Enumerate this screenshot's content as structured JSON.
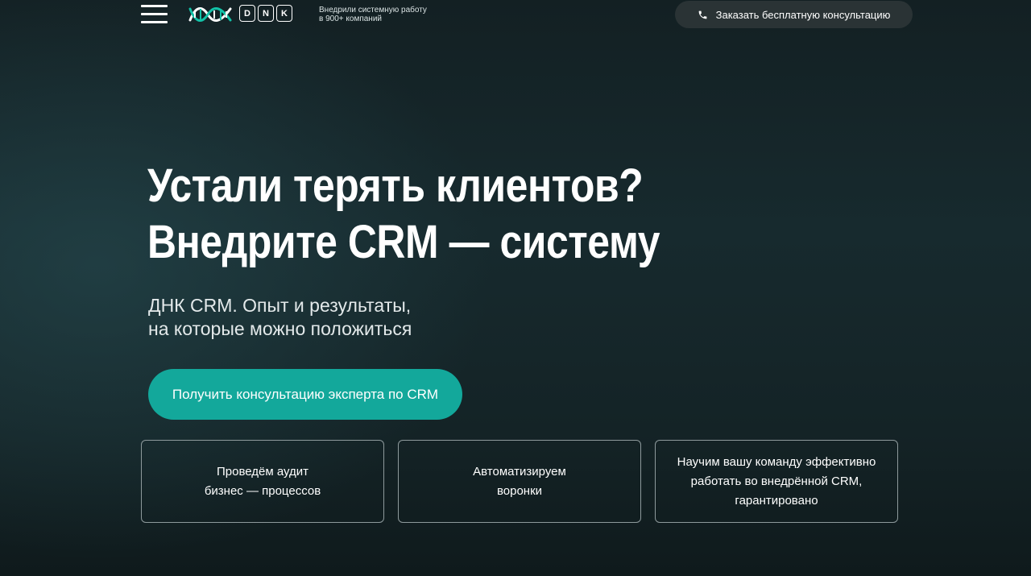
{
  "header": {
    "menu_icon": "hamburger-menu-icon",
    "logo_icon": "dnk-helix-logo-icon",
    "logo_letters": [
      "D",
      "N",
      "K"
    ],
    "tagline": [
      "Внедрили системную работу",
      "в 900+ компаний"
    ],
    "consult_button": {
      "icon": "phone-icon",
      "label": "Заказать бесплатную консультацию"
    }
  },
  "hero": {
    "title_lines": [
      "Устали терять клиентов?",
      "Внедрите CRM — систему"
    ],
    "subtitle_lines": [
      "ДНК CRM. Опыт и результаты,",
      "на которые можно положиться"
    ],
    "cta_label": "Получить консультацию эксперта по CRM"
  },
  "features": [
    {
      "lines": [
        "Проведём аудит",
        "бизнес — процессов"
      ]
    },
    {
      "lines": [
        "Автоматизируем",
        "воронки"
      ]
    },
    {
      "lines": [
        "Научим вашу команду эффективно",
        "работать во внедрённой CRM,",
        "гарантировано"
      ]
    }
  ],
  "colors": {
    "accent": "#13a89b",
    "background": "#172a2e",
    "button_dark": "#2a3335",
    "card_border": "#8e9a9c"
  }
}
